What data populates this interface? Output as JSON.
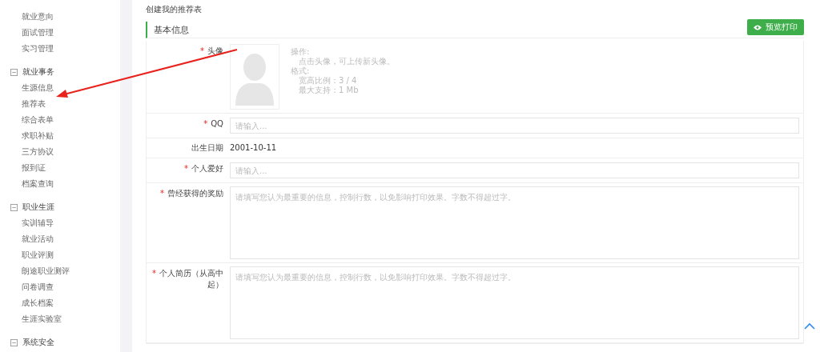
{
  "sidebar": {
    "groups": [
      {
        "items": [
          "就业意向",
          "面试管理",
          "实习管理"
        ]
      },
      {
        "label": "就业事务",
        "expanded": true,
        "items": [
          "生源信息",
          "推荐表",
          "综合表单",
          "求职补贴",
          "三方协议",
          "报到证",
          "档案查询"
        ]
      },
      {
        "label": "职业生涯",
        "expanded": true,
        "items": [
          "实训辅导",
          "就业活动",
          "职业评测",
          "朗途职业测评",
          "问卷调查",
          "成长档案",
          "生涯实验室"
        ]
      },
      {
        "label": "系统安全",
        "expanded": true
      }
    ]
  },
  "page_title": "创建我的推荐表",
  "section": {
    "title": "基本信息",
    "button": "预览打印"
  },
  "fields": [
    {
      "kind": "avatar",
      "mark": "*",
      "label": "头像",
      "hints": [
        {
          "text": "操作:",
          "indent": false
        },
        {
          "text": "点击头像，可上传新头像。",
          "indent": true
        },
        {
          "text": "格式:",
          "indent": false
        },
        {
          "text": "宽高比例：3 / 4",
          "indent": true
        },
        {
          "text": "最大支持：1 Mb",
          "indent": true
        }
      ]
    },
    {
      "kind": "input",
      "mark": "*",
      "label": "QQ",
      "placeholder": "请输入..."
    },
    {
      "kind": "text",
      "label": "出生日期",
      "value": "2001-10-11"
    },
    {
      "kind": "input",
      "mark": "*",
      "label": "个人爱好",
      "placeholder": "请输入..."
    },
    {
      "kind": "textarea",
      "mark": "*",
      "label": "曾经获得的奖励",
      "placeholder": "请填写您认为最重要的信息，控制行数，以免影响打印效果。字数不得超过字。"
    },
    {
      "kind": "textarea",
      "mark": "*",
      "label": "个人简历（从高中起）",
      "placeholder": "请填写您认为最重要的信息，控制行数，以免影响打印效果。字数不得超过字。"
    }
  ]
}
